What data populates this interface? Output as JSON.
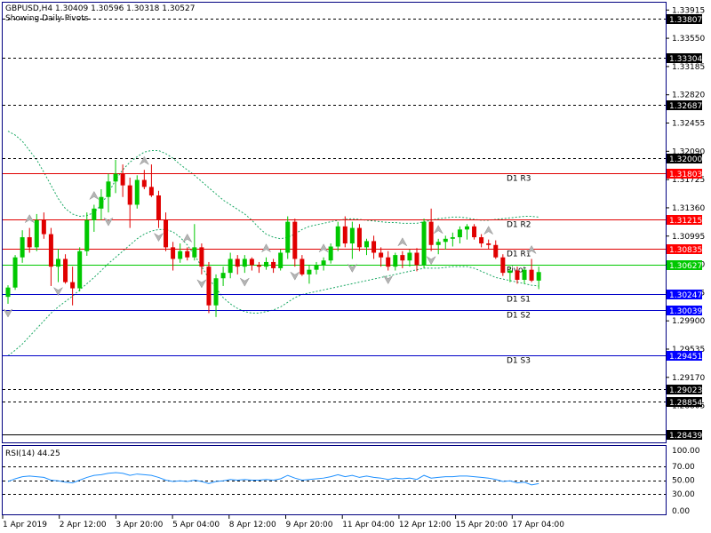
{
  "header": {
    "symbol_line": "GBPUSD,H4  1.30409 1.30596 1.30318 1.30527",
    "subtitle": "Showing Daily Pivots"
  },
  "colors": {
    "frame": "#000080",
    "bull": "#00c800",
    "bear": "#e00000",
    "band": "#1aa864",
    "pivot_red": "#e00000",
    "pivot_green": "#00c800",
    "pivot_blue": "#0000c8",
    "rsi_line": "#1e90ff",
    "label_red_bg": "#ff0000",
    "label_green_bg": "#00c800",
    "label_blue_bg": "#0000ff"
  },
  "price_axis": {
    "min": 1.2833,
    "max": 1.3401,
    "ticks": [
      "1.33915",
      "1.33550",
      "1.33185",
      "1.32820",
      "1.32455",
      "1.32090",
      "1.31725",
      "1.31360",
      "1.30995",
      "1.30630",
      "1.30265",
      "1.29900",
      "1.29535",
      "1.29170",
      "1.28805"
    ]
  },
  "time_axis": {
    "labels": [
      "1 Apr 2019",
      "2 Apr 12:00",
      "3 Apr 20:00",
      "5 Apr 04:00",
      "8 Apr 12:00",
      "9 Apr 20:00",
      "11 Apr 04:00",
      "12 Apr 12:00",
      "15 Apr 20:00",
      "17 Apr 04:00"
    ]
  },
  "levels": [
    {
      "price": 1.33807,
      "label": "1.33807",
      "style": "dashed",
      "color": "black"
    },
    {
      "price": 1.33304,
      "label": "1.33304",
      "style": "dashed",
      "color": "black"
    },
    {
      "price": 1.32687,
      "label": "1.32687",
      "style": "dashed",
      "color": "black"
    },
    {
      "price": 1.32,
      "label": "1.32000",
      "style": "dashed",
      "color": "black"
    },
    {
      "price": 1.31803,
      "label": "1.31803",
      "style": "solid",
      "color": "red",
      "name": "D1  R3"
    },
    {
      "price": 1.31215,
      "label": "1.31215",
      "style": "solid",
      "color": "red",
      "name": "D1  R2"
    },
    {
      "price": 1.30835,
      "label": "1.30835",
      "style": "solid",
      "color": "red",
      "name": "D1  R1"
    },
    {
      "price": 1.30627,
      "label": "1.30627",
      "style": "solid",
      "color": "green",
      "name": "Pivot"
    },
    {
      "price": 1.30247,
      "label": "1.30247",
      "style": "solid",
      "color": "blue",
      "name": "D1  S1"
    },
    {
      "price": 1.30039,
      "label": "1.30039",
      "style": "solid",
      "color": "blue",
      "name": "D1  S2"
    },
    {
      "price": 1.29451,
      "label": "1.29451",
      "style": "solid",
      "color": "blue",
      "name": "D1  S3"
    },
    {
      "price": 1.29023,
      "label": "1.29023",
      "style": "dashed",
      "color": "black"
    },
    {
      "price": 1.28854,
      "label": "1.28854",
      "style": "dashed",
      "color": "black"
    },
    {
      "price": 1.28439,
      "label": "1.28439",
      "style": "solid",
      "color": "black"
    }
  ],
  "candles": [
    [
      1.3021,
      1.3036,
      1.3012,
      1.3033
    ],
    [
      1.3033,
      1.3075,
      1.303,
      1.3072
    ],
    [
      1.3072,
      1.3107,
      1.3065,
      1.3098
    ],
    [
      1.3098,
      1.311,
      1.3078,
      1.3085
    ],
    [
      1.3085,
      1.3128,
      1.308,
      1.312
    ],
    [
      1.312,
      1.313,
      1.3096,
      1.3102
    ],
    [
      1.3102,
      1.311,
      1.3035,
      1.306
    ],
    [
      1.306,
      1.3083,
      1.304,
      1.307
    ],
    [
      1.307,
      1.3076,
      1.3038,
      1.304
    ],
    [
      1.304,
      1.306,
      1.301,
      1.3032
    ],
    [
      1.3032,
      1.3085,
      1.3028,
      1.308
    ],
    [
      1.308,
      1.313,
      1.3074,
      1.312
    ],
    [
      1.312,
      1.314,
      1.3105,
      1.3135
    ],
    [
      1.3135,
      1.316,
      1.312,
      1.315
    ],
    [
      1.315,
      1.318,
      1.313,
      1.317
    ],
    [
      1.317,
      1.3198,
      1.3155,
      1.318
    ],
    [
      1.318,
      1.3192,
      1.315,
      1.3165
    ],
    [
      1.3165,
      1.3175,
      1.311,
      1.314
    ],
    [
      1.314,
      1.3178,
      1.3135,
      1.3172
    ],
    [
      1.3172,
      1.3185,
      1.316,
      1.3163
    ],
    [
      1.3163,
      1.3192,
      1.315,
      1.3152
    ],
    [
      1.3152,
      1.3158,
      1.311,
      1.312
    ],
    [
      1.312,
      1.313,
      1.308,
      1.3085
    ],
    [
      1.3085,
      1.3092,
      1.3055,
      1.307
    ],
    [
      1.307,
      1.309,
      1.3065,
      1.308
    ],
    [
      1.308,
      1.3085,
      1.3068,
      1.3072
    ],
    [
      1.3072,
      1.3115,
      1.3068,
      1.3085
    ],
    [
      1.3085,
      1.309,
      1.305,
      1.306
    ],
    [
      1.306,
      1.3066,
      1.3,
      1.301
    ],
    [
      1.301,
      1.305,
      1.2995,
      1.3045
    ],
    [
      1.3045,
      1.306,
      1.3035,
      1.3052
    ],
    [
      1.3052,
      1.3078,
      1.3045,
      1.307
    ],
    [
      1.307,
      1.3075,
      1.305,
      1.306
    ],
    [
      1.306,
      1.3075,
      1.3052,
      1.307
    ],
    [
      1.307,
      1.3072,
      1.3055,
      1.3062
    ],
    [
      1.3062,
      1.3066,
      1.3052,
      1.306
    ],
    [
      1.306,
      1.3072,
      1.3056,
      1.3066
    ],
    [
      1.3066,
      1.307,
      1.3052,
      1.3058
    ],
    [
      1.3058,
      1.3082,
      1.3055,
      1.3078
    ],
    [
      1.3078,
      1.3125,
      1.307,
      1.3118
    ],
    [
      1.3118,
      1.3122,
      1.306,
      1.307
    ],
    [
      1.307,
      1.3075,
      1.3048,
      1.305
    ],
    [
      1.305,
      1.3062,
      1.3038,
      1.3056
    ],
    [
      1.3056,
      1.3066,
      1.305,
      1.3062
    ],
    [
      1.3062,
      1.3072,
      1.3055,
      1.3068
    ],
    [
      1.3068,
      1.309,
      1.3064,
      1.3086
    ],
    [
      1.3086,
      1.3118,
      1.308,
      1.3112
    ],
    [
      1.3112,
      1.3125,
      1.3085,
      1.309
    ],
    [
      1.309,
      1.3118,
      1.307,
      1.311
    ],
    [
      1.311,
      1.3115,
      1.308,
      1.3085
    ],
    [
      1.3085,
      1.3096,
      1.3075,
      1.3093
    ],
    [
      1.3093,
      1.31,
      1.307,
      1.3078
    ],
    [
      1.3078,
      1.3085,
      1.306,
      1.3072
    ],
    [
      1.3072,
      1.308,
      1.3055,
      1.306
    ],
    [
      1.306,
      1.3078,
      1.3055,
      1.3075
    ],
    [
      1.3075,
      1.308,
      1.3058,
      1.3068
    ],
    [
      1.3068,
      1.3082,
      1.306,
      1.3078
    ],
    [
      1.3078,
      1.3084,
      1.3054,
      1.3062
    ],
    [
      1.3062,
      1.3122,
      1.3058,
      1.3118
    ],
    [
      1.3118,
      1.3135,
      1.308,
      1.3088
    ],
    [
      1.3088,
      1.3096,
      1.3076,
      1.3092
    ],
    [
      1.3092,
      1.31,
      1.3082,
      1.3096
    ],
    [
      1.3096,
      1.3104,
      1.3086,
      1.3098
    ],
    [
      1.3098,
      1.3112,
      1.309,
      1.3108
    ],
    [
      1.3108,
      1.3115,
      1.3095,
      1.3112
    ],
    [
      1.3112,
      1.3115,
      1.3095,
      1.3098
    ],
    [
      1.3098,
      1.3102,
      1.3085,
      1.309
    ],
    [
      1.309,
      1.3095,
      1.3082,
      1.3088
    ],
    [
      1.3088,
      1.3094,
      1.307,
      1.3072
    ],
    [
      1.3072,
      1.3076,
      1.3048,
      1.3052
    ],
    [
      1.3052,
      1.306,
      1.304,
      1.3055
    ],
    [
      1.3055,
      1.306,
      1.3038,
      1.3043
    ],
    [
      1.3043,
      1.3058,
      1.3038,
      1.3056
    ],
    [
      1.3056,
      1.307,
      1.304,
      1.3042
    ],
    [
      1.3042,
      1.306,
      1.3031,
      1.3053
    ]
  ],
  "fractals": {
    "up": [
      3,
      12,
      19,
      25,
      36,
      44,
      55,
      60,
      67,
      73
    ],
    "down": [
      0,
      7,
      14,
      21,
      27,
      33,
      40,
      48,
      53,
      59
    ]
  },
  "bands": {
    "upper": [
      1.3235,
      1.323,
      1.3222,
      1.321,
      1.3198,
      1.3182,
      1.3165,
      1.3148,
      1.3135,
      1.3128,
      1.3125,
      1.3126,
      1.313,
      1.314,
      1.3155,
      1.3172,
      1.3185,
      1.3195,
      1.3202,
      1.3208,
      1.321,
      1.321,
      1.3206,
      1.32,
      1.3192,
      1.3185,
      1.3178,
      1.317,
      1.3162,
      1.3154,
      1.3146,
      1.314,
      1.3134,
      1.3128,
      1.312,
      1.311,
      1.3102,
      1.3098,
      1.3096,
      1.3098,
      1.3102,
      1.3108,
      1.3112,
      1.3114,
      1.3116,
      1.3118,
      1.312,
      1.3121,
      1.3122,
      1.3121,
      1.312,
      1.3119,
      1.3118,
      1.3117,
      1.3117,
      1.3116,
      1.3116,
      1.3116,
      1.3118,
      1.312,
      1.3122,
      1.3123,
      1.3124,
      1.3124,
      1.3123,
      1.3121,
      1.312,
      1.312,
      1.3121,
      1.3122,
      1.3123,
      1.3124,
      1.3125,
      1.3125,
      1.3124
    ],
    "lower": [
      1.2945,
      1.2952,
      1.296,
      1.297,
      1.298,
      1.299,
      1.3,
      1.3008,
      1.3015,
      1.3022,
      1.303,
      1.3038,
      1.3046,
      1.3055,
      1.3064,
      1.3072,
      1.308,
      1.3088,
      1.3096,
      1.3102,
      1.3106,
      1.3108,
      1.3108,
      1.3105,
      1.3098,
      1.3088,
      1.3075,
      1.306,
      1.3045,
      1.3032,
      1.302,
      1.3012,
      1.3006,
      1.3002,
      1.3,
      1.3,
      1.3002,
      1.3004,
      1.3008,
      1.3014,
      1.302,
      1.3024,
      1.3026,
      1.3028,
      1.303,
      1.3032,
      1.3034,
      1.3036,
      1.3038,
      1.304,
      1.3042,
      1.3044,
      1.3046,
      1.3048,
      1.305,
      1.3052,
      1.3054,
      1.3056,
      1.3058,
      1.3058,
      1.3058,
      1.3059,
      1.306,
      1.306,
      1.306,
      1.3058,
      1.3054,
      1.305,
      1.3046,
      1.3044,
      1.3042,
      1.304,
      1.3038,
      1.3036,
      1.3035
    ]
  },
  "rsi": {
    "label": "RSI(14) 44.25",
    "min": 0,
    "max": 100,
    "ticks": [
      "100.00",
      "70.00",
      "50.00",
      "30.00",
      "0.00"
    ],
    "levels": [
      70,
      50,
      30
    ],
    "values": [
      48,
      52,
      55,
      56,
      55,
      54,
      50,
      49,
      47,
      46,
      50,
      54,
      57,
      58,
      60,
      61,
      60,
      57,
      59,
      58,
      57,
      54,
      50,
      48,
      49,
      48,
      50,
      48,
      45,
      48,
      49,
      51,
      50,
      51,
      50,
      50,
      51,
      50,
      52,
      57,
      53,
      50,
      51,
      52,
      53,
      55,
      58,
      55,
      57,
      54,
      56,
      54,
      53,
      51,
      53,
      52,
      53,
      51,
      57,
      53,
      54,
      55,
      55,
      56,
      56,
      55,
      54,
      53,
      51,
      48,
      49,
      46,
      47,
      43,
      45
    ]
  }
}
